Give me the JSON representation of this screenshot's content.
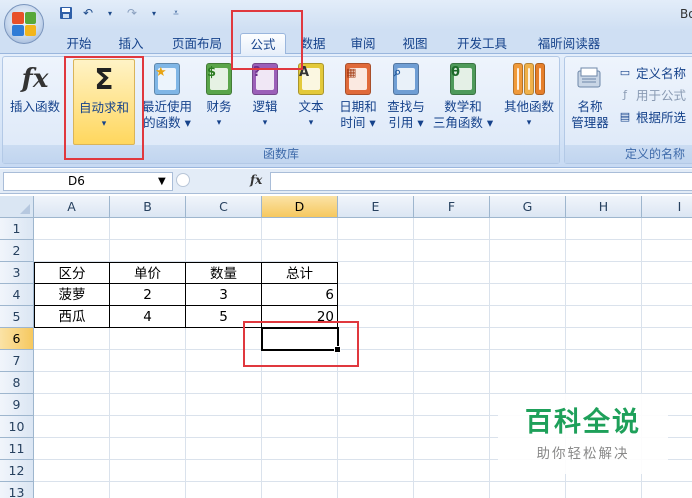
{
  "title_bar": {
    "title": "Bo"
  },
  "tabs": [
    {
      "label": "开始"
    },
    {
      "label": "插入"
    },
    {
      "label": "页面布局"
    },
    {
      "label": "公式",
      "active": true
    },
    {
      "label": "数据"
    },
    {
      "label": "审阅"
    },
    {
      "label": "视图"
    },
    {
      "label": "开发工具"
    },
    {
      "label": "福昕阅读器"
    }
  ],
  "ribbon": {
    "function_library": {
      "group_label": "函数库",
      "buttons": [
        {
          "line1": "插入函数",
          "line2": "",
          "icon": "fx-icon"
        },
        {
          "line1": "自动求和",
          "line2": "▾",
          "icon": "sigma-icon"
        },
        {
          "line1": "最近使用",
          "line2": "的函数 ▾",
          "icon": "star-book-icon"
        },
        {
          "line1": "财务",
          "line2": "▾",
          "icon": "money-book-icon"
        },
        {
          "line1": "逻辑",
          "line2": "▾",
          "icon": "question-book-icon"
        },
        {
          "line1": "文本",
          "line2": "▾",
          "icon": "text-book-icon"
        },
        {
          "line1": "日期和",
          "line2": "时间 ▾",
          "icon": "calendar-book-icon"
        },
        {
          "line1": "查找与",
          "line2": "引用 ▾",
          "icon": "search-book-icon"
        },
        {
          "line1": "数学和",
          "line2": "三角函数 ▾",
          "icon": "theta-book-icon"
        },
        {
          "line1": "其他函数",
          "line2": "▾",
          "icon": "more-books-icon"
        }
      ]
    },
    "defined_names": {
      "group_label": "定义的名称",
      "name_manager": {
        "line1": "名称",
        "line2": "管理器",
        "icon": "name-manager-icon"
      },
      "small_items": [
        {
          "label": "定义名称",
          "icon": "define-name-icon",
          "enabled": true
        },
        {
          "label": "用于公式",
          "icon": "use-in-formula-icon",
          "enabled": false
        },
        {
          "label": "根据所选",
          "icon": "create-from-selection-icon",
          "enabled": true
        }
      ]
    }
  },
  "formula_bar": {
    "name_box": "D6",
    "fx_label": "fx",
    "formula": ""
  },
  "sheet": {
    "columns": [
      "A",
      "B",
      "C",
      "D",
      "E",
      "F",
      "G",
      "H",
      "I"
    ],
    "rows": [
      "1",
      "2",
      "3",
      "4",
      "5",
      "6",
      "7",
      "8",
      "9",
      "10",
      "11",
      "12",
      "13"
    ],
    "selected_cell": "D6",
    "table": {
      "headers": [
        "区分",
        "单价",
        "数量",
        "总计"
      ],
      "rows": [
        [
          "菠萝",
          "2",
          "3",
          "6"
        ],
        [
          "西瓜",
          "4",
          "5",
          "20"
        ]
      ]
    }
  },
  "watermark": {
    "title": "百科全说",
    "subtitle": "助你轻松解决"
  },
  "colors": {
    "highlight_red": "#e0383e",
    "ribbon_blue": "#15428b",
    "watermark_green": "#1ea05a",
    "selected_header": "#f6c85f"
  }
}
